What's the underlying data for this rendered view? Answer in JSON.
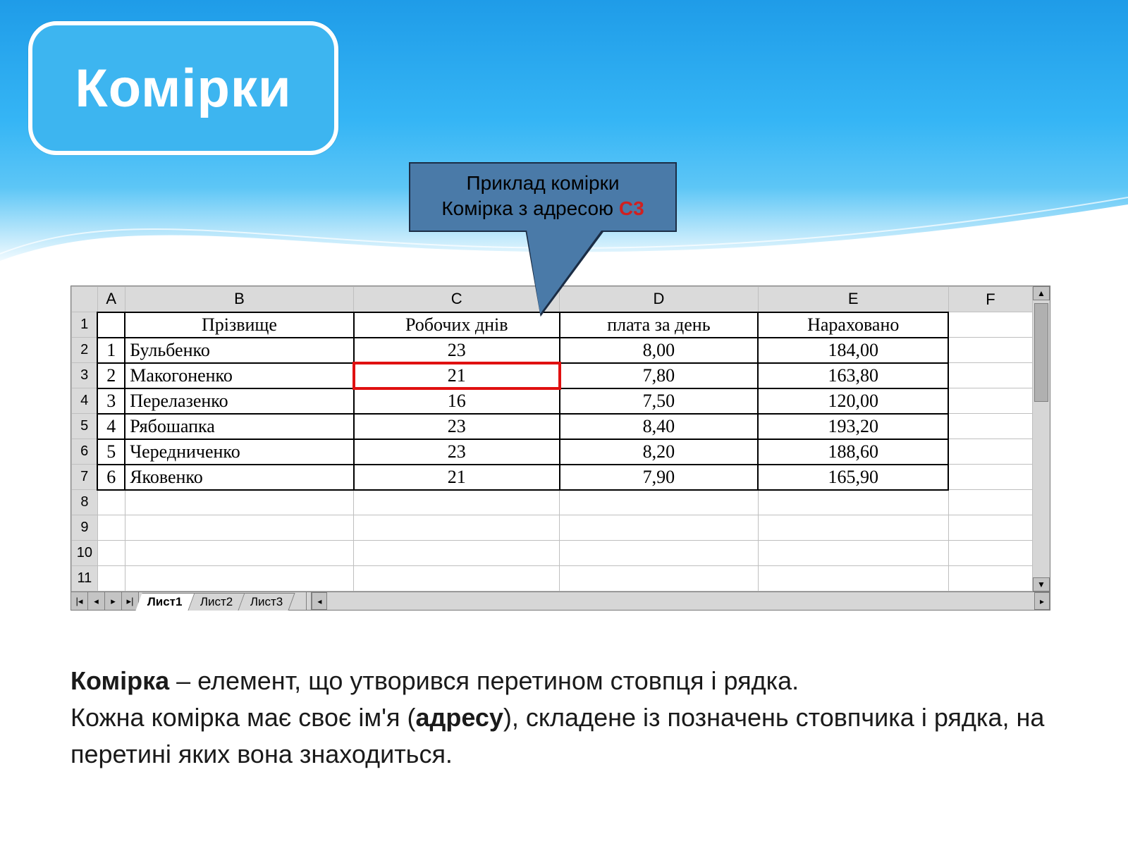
{
  "title": "Комірки",
  "callout": {
    "line1": "Приклад комірки",
    "line2_prefix": "Комірка з адресою ",
    "line2_address": "C3"
  },
  "spreadsheet": {
    "columns": [
      "A",
      "B",
      "C",
      "D",
      "E",
      "F"
    ],
    "row_numbers": [
      1,
      2,
      3,
      4,
      5,
      6,
      7,
      8,
      9,
      10,
      11
    ],
    "headers": {
      "B": "Прізвище",
      "C": "Робочих днів",
      "D": "плата за день",
      "E": "Нараховано"
    },
    "rows": [
      {
        "n": "1",
        "name": "Бульбенко",
        "days": "23",
        "rate": "8,00",
        "total": "184,00"
      },
      {
        "n": "2",
        "name": "Макогоненко",
        "days": "21",
        "rate": "7,80",
        "total": "163,80"
      },
      {
        "n": "3",
        "name": "Перелазенко",
        "days": "16",
        "rate": "7,50",
        "total": "120,00"
      },
      {
        "n": "4",
        "name": "Рябошапка",
        "days": "23",
        "rate": "8,40",
        "total": "193,20"
      },
      {
        "n": "5",
        "name": "Чередниченко",
        "days": "23",
        "rate": "8,20",
        "total": "188,60"
      },
      {
        "n": "6",
        "name": "Яковенко",
        "days": "21",
        "rate": "7,90",
        "total": "165,90"
      }
    ],
    "highlight": {
      "row_index": 1,
      "col": "C"
    },
    "sheet_tabs": [
      "Лист1",
      "Лист2",
      "Лист3"
    ],
    "active_tab": 0
  },
  "definition": {
    "term": "Комірка",
    "part1": " – елемент, що утворився перетином стовпця і рядка.",
    "part2a": "Кожна комірка має своє ім'я (",
    "term2": "адресу",
    "part2b": "), складене із позначень стовпчика і рядка, на перетині яких вона знаходиться."
  }
}
